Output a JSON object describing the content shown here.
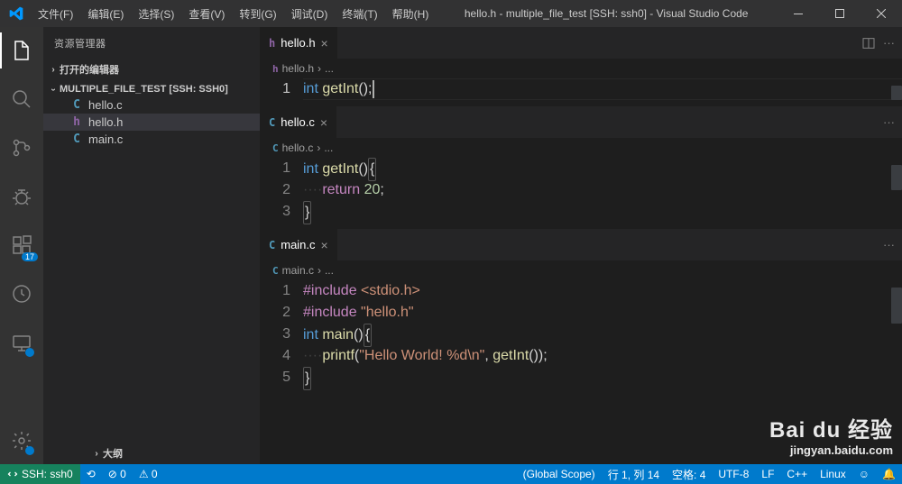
{
  "titlebar": {
    "menu": [
      "文件(F)",
      "编辑(E)",
      "选择(S)",
      "查看(V)",
      "转到(G)",
      "调试(D)",
      "终端(T)",
      "帮助(H)"
    ],
    "title": "hello.h - multiple_file_test [SSH: ssh0] - Visual Studio Code"
  },
  "sidebar": {
    "header": "资源管理器",
    "openEditors": "打开的编辑器",
    "workspace": "MULTIPLE_FILE_TEST [SSH: SSH0]",
    "files": [
      {
        "icon": "C",
        "iconClass": "icon-c",
        "name": "hello.c",
        "active": false
      },
      {
        "icon": "h",
        "iconClass": "icon-h",
        "name": "hello.h",
        "active": true
      },
      {
        "icon": "C",
        "iconClass": "icon-c",
        "name": "main.c",
        "active": false
      }
    ],
    "outline": "大纲",
    "extBadge": "17"
  },
  "editors": [
    {
      "tab": {
        "icon": "h",
        "iconClass": "icon-h",
        "name": "hello.h",
        "close": "×",
        "actions": [
          "split",
          "more"
        ]
      },
      "breadcrumb": {
        "icon": "h",
        "iconClass": "icon-h",
        "name": "hello.h",
        "sep": "›",
        "rest": "..."
      },
      "activeLine": 1,
      "lines": [
        {
          "n": "1",
          "tokens": [
            [
              "kw",
              "int "
            ],
            [
              "fn",
              "getInt"
            ],
            [
              "pn",
              "()"
            ],
            [
              "pn",
              ";"
            ]
          ],
          "cursor": true
        }
      ]
    },
    {
      "tab": {
        "icon": "C",
        "iconClass": "icon-c",
        "name": "hello.c",
        "close": "×",
        "actions": [
          "more"
        ]
      },
      "breadcrumb": {
        "icon": "C",
        "iconClass": "icon-c",
        "name": "hello.c",
        "sep": "›",
        "rest": "..."
      },
      "lines": [
        {
          "n": "1",
          "tokens": [
            [
              "kw",
              "int "
            ],
            [
              "fn",
              "getInt"
            ],
            [
              "pn",
              "()"
            ],
            [
              "br",
              "{"
            ]
          ]
        },
        {
          "n": "2",
          "tokens": [
            [
              "ws",
              "····"
            ],
            [
              "ret",
              "return "
            ],
            [
              "num",
              "20"
            ],
            [
              "pn",
              ";"
            ]
          ]
        },
        {
          "n": "3",
          "tokens": [
            [
              "br",
              "}"
            ]
          ]
        }
      ]
    },
    {
      "tab": {
        "icon": "C",
        "iconClass": "icon-c",
        "name": "main.c",
        "close": "×",
        "actions": [
          "more"
        ]
      },
      "breadcrumb": {
        "icon": "C",
        "iconClass": "icon-c",
        "name": "main.c",
        "sep": "›",
        "rest": "..."
      },
      "lines": [
        {
          "n": "1",
          "tokens": [
            [
              "inc",
              "#include "
            ],
            [
              "str",
              "<stdio.h>"
            ]
          ]
        },
        {
          "n": "2",
          "tokens": [
            [
              "inc",
              "#include "
            ],
            [
              "str",
              "\"hello.h\""
            ]
          ]
        },
        {
          "n": "3",
          "tokens": [
            [
              "kw",
              "int "
            ],
            [
              "fn",
              "main"
            ],
            [
              "pn",
              "()"
            ],
            [
              "br",
              "{"
            ]
          ]
        },
        {
          "n": "4",
          "tokens": [
            [
              "ws",
              "····"
            ],
            [
              "fn",
              "printf"
            ],
            [
              "pn",
              "("
            ],
            [
              "str",
              "\"Hello World! %d\\n\""
            ],
            [
              "pn",
              ", "
            ],
            [
              "fn",
              "getInt"
            ],
            [
              "pn",
              "());"
            ]
          ]
        },
        {
          "n": "5",
          "tokens": [
            [
              "br",
              "}"
            ]
          ]
        }
      ]
    }
  ],
  "statusbar": {
    "remote": "SSH: ssh0",
    "sync": "⟲",
    "errors": "⊘ 0",
    "warnings": "⚠ 0",
    "scope": "(Global Scope)",
    "lncol": "行 1, 列 14",
    "spaces": "空格: 4",
    "encoding": "UTF-8",
    "eol": "LF",
    "lang": "C++",
    "os": "Linux",
    "feedback": "☺",
    "bell": "🔔"
  },
  "watermark": {
    "l1": "Bai du 经验",
    "l2": "jingyan.baidu.com"
  }
}
